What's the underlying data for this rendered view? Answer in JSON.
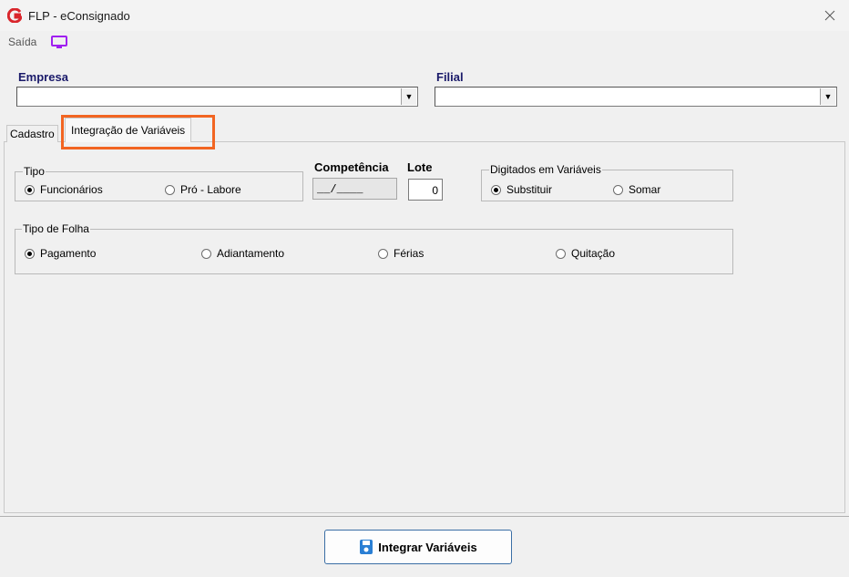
{
  "window": {
    "title": "FLP - eConsignado"
  },
  "menu": {
    "saida": "Saída"
  },
  "empresa": {
    "label": "Empresa",
    "value": ""
  },
  "filial": {
    "label": "Filial",
    "value": ""
  },
  "tabs": [
    {
      "label": "Cadastro"
    },
    {
      "label": "Integração de Variáveis"
    }
  ],
  "tipo": {
    "title": "Tipo",
    "options": [
      "Funcionários",
      "Pró - Labore"
    ],
    "selected": "Funcionários"
  },
  "competencia": {
    "label": "Competência",
    "value": "__/____"
  },
  "lote": {
    "label": "Lote",
    "value": "0"
  },
  "digitados": {
    "title": "Digitados em Variáveis",
    "options": [
      "Substituir",
      "Somar"
    ],
    "selected": "Substituir"
  },
  "tipo_folha": {
    "title": "Tipo de Folha",
    "options": [
      "Pagamento",
      "Adiantamento",
      "Férias",
      "Quitação"
    ],
    "selected": "Pagamento"
  },
  "actions": {
    "integrar": "Integrar Variáveis"
  },
  "colors": {
    "highlight": "#f26522",
    "label_blue": "#1a1a6a",
    "button_border": "#3a6ea5",
    "monitor_icon": "#a020f0"
  },
  "icons": [
    "app-logo-icon",
    "close-icon",
    "monitor-icon",
    "chevron-down-icon",
    "save-icon"
  ]
}
